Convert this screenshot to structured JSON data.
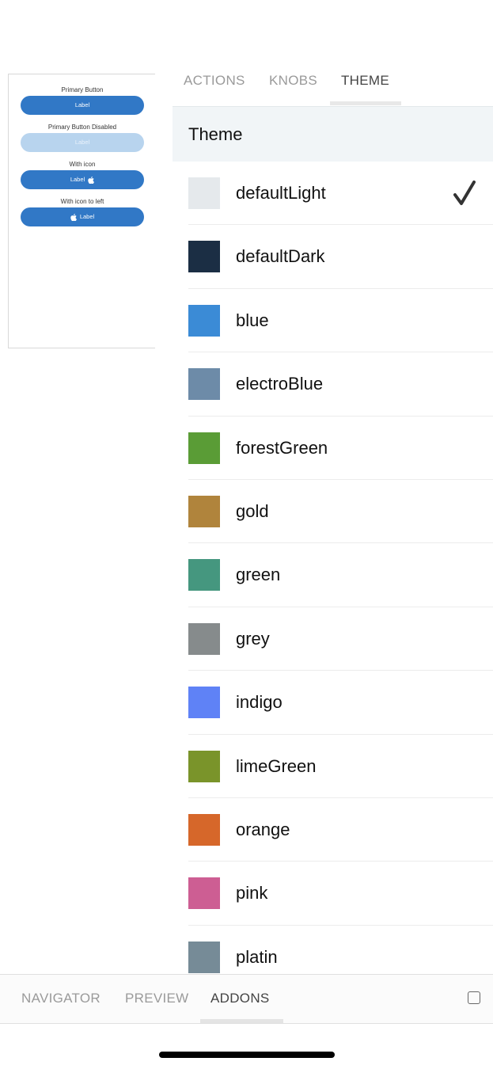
{
  "preview": {
    "groups": [
      {
        "caption": "Primary Button",
        "button_label": "Label",
        "state": "enabled",
        "icon": "none"
      },
      {
        "caption": "Primary Button Disabled",
        "button_label": "Label",
        "state": "disabled",
        "icon": "none"
      },
      {
        "caption": "With icon",
        "button_label": "Label",
        "state": "enabled",
        "icon": "apple-icon-right"
      },
      {
        "caption": "With icon to left",
        "button_label": "Label",
        "state": "enabled",
        "icon": "apple-icon-left"
      }
    ],
    "button_color": "#3178c6",
    "disabled_color": "#b8d4ee"
  },
  "addon_tabs": [
    {
      "label": "ACTIONS",
      "active": false
    },
    {
      "label": "KNOBS",
      "active": false
    },
    {
      "label": "THEME",
      "active": true
    }
  ],
  "theme_panel": {
    "header": "Theme",
    "selected": "defaultLight",
    "themes": [
      {
        "name": "defaultLight",
        "color": "#e5e9ec"
      },
      {
        "name": "defaultDark",
        "color": "#1b2e44"
      },
      {
        "name": "blue",
        "color": "#3b8bd6"
      },
      {
        "name": "electroBlue",
        "color": "#6d8ba8"
      },
      {
        "name": "forestGreen",
        "color": "#5a9c36"
      },
      {
        "name": "gold",
        "color": "#b0843c"
      },
      {
        "name": "green",
        "color": "#45977f"
      },
      {
        "name": "grey",
        "color": "#868b8c"
      },
      {
        "name": "indigo",
        "color": "#5f82f6"
      },
      {
        "name": "limeGreen",
        "color": "#7a942a"
      },
      {
        "name": "orange",
        "color": "#d6672a"
      },
      {
        "name": "pink",
        "color": "#cd5e93"
      },
      {
        "name": "platin",
        "color": "#768b97"
      }
    ]
  },
  "bottom_nav": {
    "tabs": [
      {
        "label": "NAVIGATOR",
        "active": false
      },
      {
        "label": "PREVIEW",
        "active": false
      },
      {
        "label": "ADDONS",
        "active": true
      }
    ],
    "checkbox_icon": "square-checkbox-icon"
  }
}
